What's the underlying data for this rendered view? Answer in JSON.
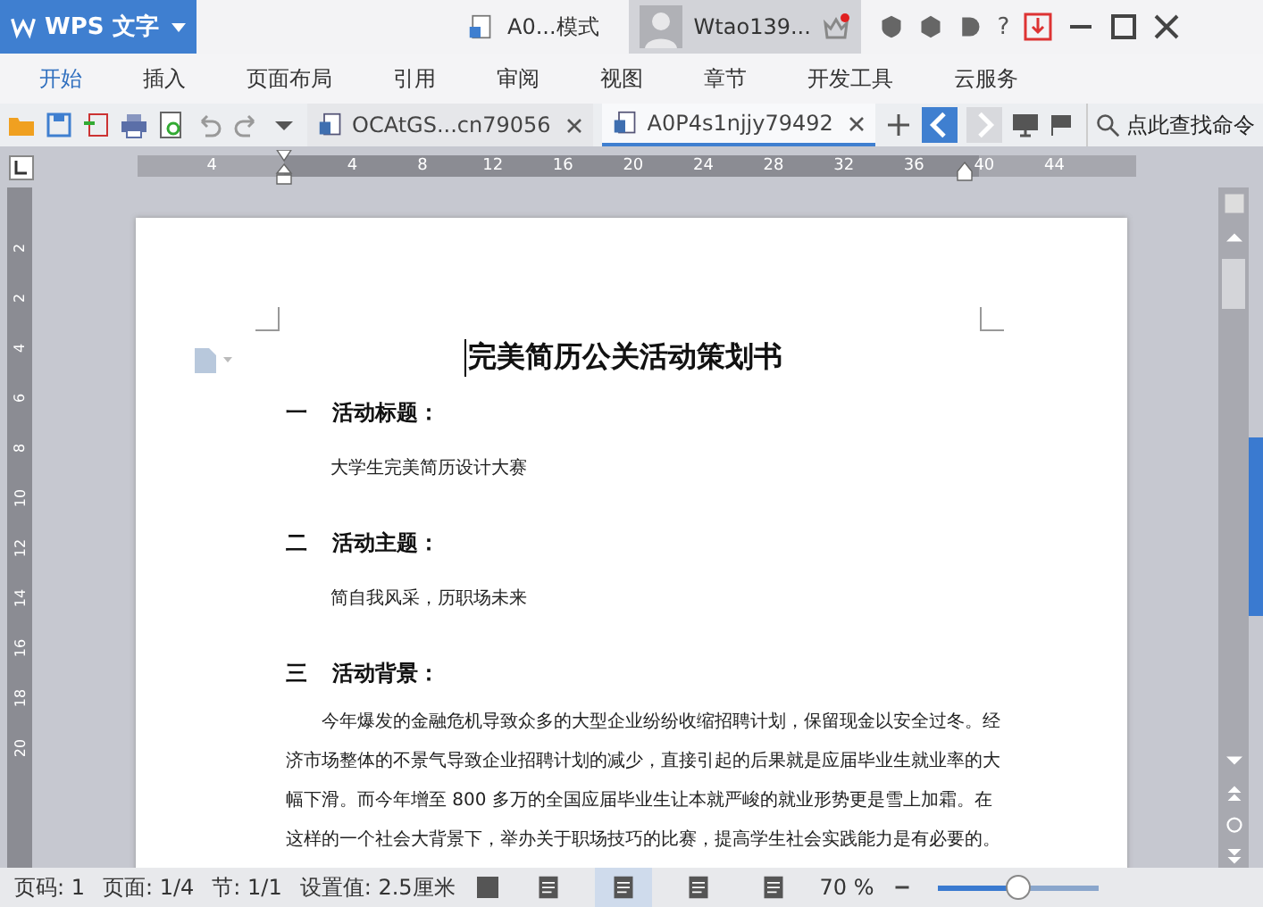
{
  "title_bar": {
    "app_button": "WPS 文字",
    "document_tab": "A0...模式",
    "user": "Wtao139...",
    "help": "?"
  },
  "menu_tabs": [
    {
      "label": "开始",
      "selected": true
    },
    {
      "label": "插入",
      "selected": false
    },
    {
      "label": "页面布局",
      "selected": false
    },
    {
      "label": "引用",
      "selected": false
    },
    {
      "label": "审阅",
      "selected": false
    },
    {
      "label": "视图",
      "selected": false
    },
    {
      "label": "章节",
      "selected": false
    },
    {
      "label": "开发工具",
      "selected": false
    },
    {
      "label": "云服务",
      "selected": false
    }
  ],
  "doc_tabs": [
    {
      "label": "OCAtGS...cn79056",
      "selected": false
    },
    {
      "label": "A0P4s1njjy79492",
      "selected": true
    }
  ],
  "command_search": {
    "placeholder": "点此查找命令"
  },
  "ruler": {
    "ticks": [
      "4",
      "4",
      "8",
      "12",
      "16",
      "20",
      "24",
      "28",
      "32",
      "36",
      "40",
      "44"
    ]
  },
  "vertical_ruler": {
    "ticks": [
      "2",
      "2",
      "4",
      "6",
      "8",
      "10",
      "12",
      "14",
      "16",
      "18",
      "20"
    ]
  },
  "document": {
    "title": "完美简历公关活动策划书",
    "sections": [
      {
        "number": "一",
        "heading": "活动标题：",
        "body": "大学生完美简历设计大赛",
        "indented": false
      },
      {
        "number": "二",
        "heading": "活动主题：",
        "body": "简自我风采，历职场未来",
        "indented": false
      },
      {
        "number": "三",
        "heading": "活动背景：",
        "body": "今年爆发的金融危机导致众多的大型企业纷纷收缩招聘计划，保留现金以安全过冬。经济市场整体的不景气导致企业招聘计划的减少，直接引起的后果就是应届毕业生就业率的大幅下滑。而今年增至 800 多万的全国应届毕业生让本就严峻的就业形势更是雪上加霜。在这样的一个社会大背景下，举办关于职场技巧的比赛，提高学生社会实践能力是有必要的。",
        "indented": true
      }
    ]
  },
  "status_bar": {
    "items": [
      "页码: 1",
      "页面: 1/4",
      "节: 1/1",
      "设置值: 2.5厘米"
    ],
    "view_buttons": [
      {
        "selected": false
      },
      {
        "selected": true
      },
      {
        "selected": false
      },
      {
        "selected": false
      }
    ],
    "zoom": "70 %",
    "zoom_slider": {
      "level": 0.5
    }
  }
}
